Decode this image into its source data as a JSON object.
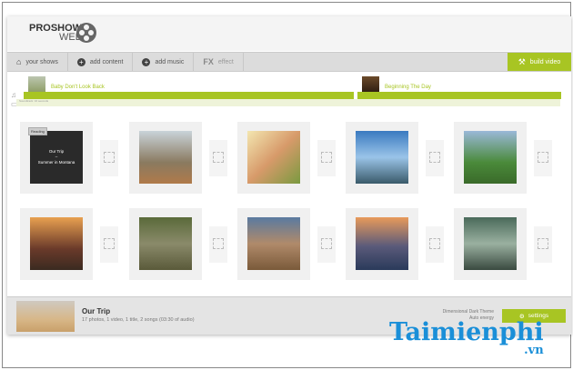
{
  "app": {
    "logo_top": "PROSHOW",
    "logo_bottom": "WEB"
  },
  "toolbar": {
    "items": [
      {
        "label": "your shows",
        "icon": "home-icon"
      },
      {
        "label": "add content",
        "icon": "plus-circle-icon"
      },
      {
        "label": "add music",
        "icon": "plus-circle-icon"
      },
      {
        "label": "effect",
        "icon": "fx-icon",
        "icon_text": "FX"
      }
    ],
    "build": "build video"
  },
  "timeline": {
    "songs": [
      "Baby Don't Look Back",
      "Beginning The Day"
    ],
    "subtrack": "Soundtrack: 16 seconds"
  },
  "slides": {
    "reading_badge": "Reading",
    "title_card": [
      "Our Trip",
      "–",
      "Summer in Montana"
    ]
  },
  "footer": {
    "title": "Our Trip",
    "subtitle": "17 photos, 1 video, 1 title, 2 songs (03:30 of audio)",
    "theme_line1": "Dimensional Dark Theme",
    "theme_line2": "Auto energy",
    "settings": "settings"
  },
  "watermark": {
    "text": "Taimienphi",
    "suffix": ".vn"
  },
  "colors": {
    "accent": "#a8c523",
    "watermark": "#1a8fd8"
  }
}
